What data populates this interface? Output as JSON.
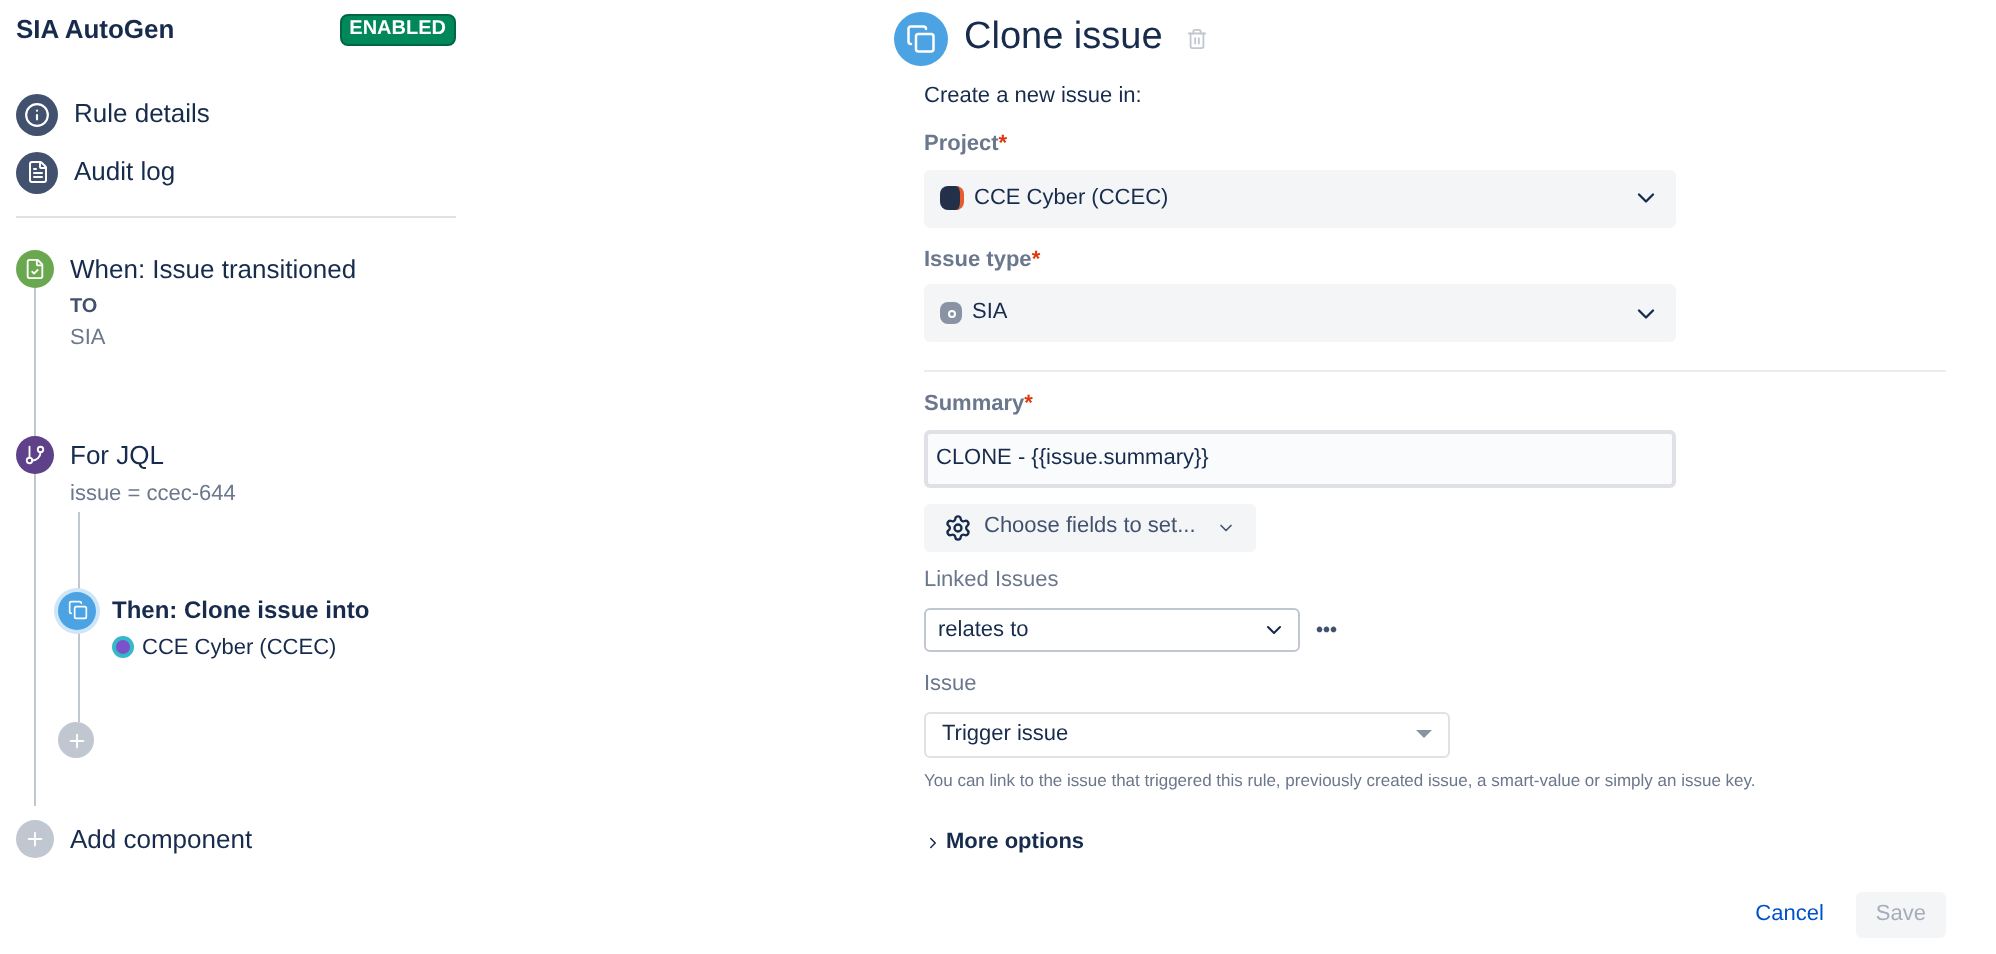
{
  "rule": {
    "title": "SIA AutoGen",
    "status": "ENABLED"
  },
  "nav": [
    {
      "kind": "info",
      "label": "Rule details"
    },
    {
      "kind": "log",
      "label": "Audit log"
    }
  ],
  "trigger": {
    "title": "When: Issue transitioned",
    "lines": [
      "TO",
      "SIA"
    ]
  },
  "branch": {
    "title": "For JQL",
    "query": "issue = ccec-644",
    "action": {
      "title": "Then: Clone issue into",
      "project": "CCE Cyber (CCEC)"
    }
  },
  "add_component": "Add component",
  "panel": {
    "title": "Clone issue",
    "intro": "Create a new issue in:",
    "project": {
      "label": "Project",
      "required_mark": "*",
      "value": "CCE Cyber (CCEC)"
    },
    "issue_type": {
      "label": "Issue type",
      "required_mark": "*",
      "value": "SIA"
    },
    "summary": {
      "label": "Summary",
      "required_mark": "*",
      "value": "CLONE - {{issue.summary}}"
    },
    "choose_fields": "Choose fields to set...",
    "linked": {
      "label": "Linked Issues",
      "value": "relates to",
      "more": "•••"
    },
    "issue": {
      "label": "Issue",
      "value": "Trigger issue",
      "help": "You can link to the issue that triggered this rule, previously created issue, a smart-value or simply an issue key."
    },
    "more_options": {
      "label": "More options",
      "expanded": false
    },
    "buttons": [
      {
        "label": "Cancel",
        "kind": "link",
        "disabled": false
      },
      {
        "label": "Save",
        "kind": "primary",
        "disabled": true
      }
    ]
  }
}
